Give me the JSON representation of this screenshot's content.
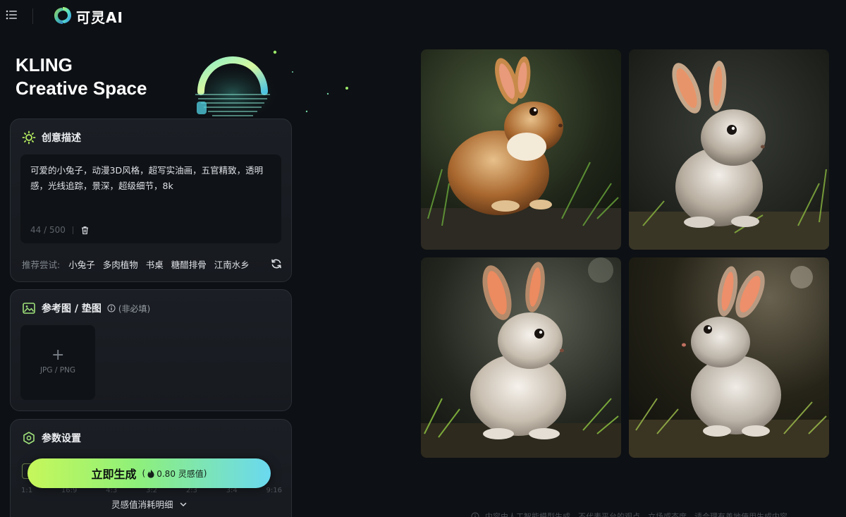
{
  "topbar": {
    "brand": "可灵AI",
    "icons": [
      "menu-icon",
      "kling-logo-icon"
    ]
  },
  "hero": {
    "line1": "KLING",
    "line2": "Creative Space"
  },
  "creative": {
    "title": "创意描述",
    "icon": "sun-icon",
    "prompt": "可爱的小兔子，动漫3D风格，超写实油画，五官精致，透明感，光线追踪，景深，超级细节，8k",
    "counter": "44 / 500",
    "suggest_label": "推荐尝试:",
    "suggestions": [
      "小兔子",
      "多肉植物",
      "书桌",
      "糖醋排骨",
      "江南水乡"
    ]
  },
  "reference": {
    "title": "参考图 / 垫图",
    "icon": "image-icon",
    "optional": "(非必填)",
    "upload_label": "JPG / PNG"
  },
  "params": {
    "title": "参数设置",
    "icon": "hexagon-icon",
    "ratios": [
      "1:1",
      "16:9",
      "4:3",
      "3:2",
      "2:3",
      "3:4",
      "9:16"
    ]
  },
  "generate": {
    "label": "立即生成",
    "cost": "0.80 灵感值",
    "accent_start": "#c6f75a",
    "accent_end": "#6ad9f0"
  },
  "detail_link": "灵感值消耗明细",
  "footer_note": "内容由人工智能模型生成，不代表平台的观点、立场或态度，请合理有善地使用生成内容。",
  "results": [
    {
      "name": "rabbit-brown"
    },
    {
      "name": "rabbit-gray-right"
    },
    {
      "name": "rabbit-white-orange-ears"
    },
    {
      "name": "rabbit-gray-left"
    }
  ]
}
